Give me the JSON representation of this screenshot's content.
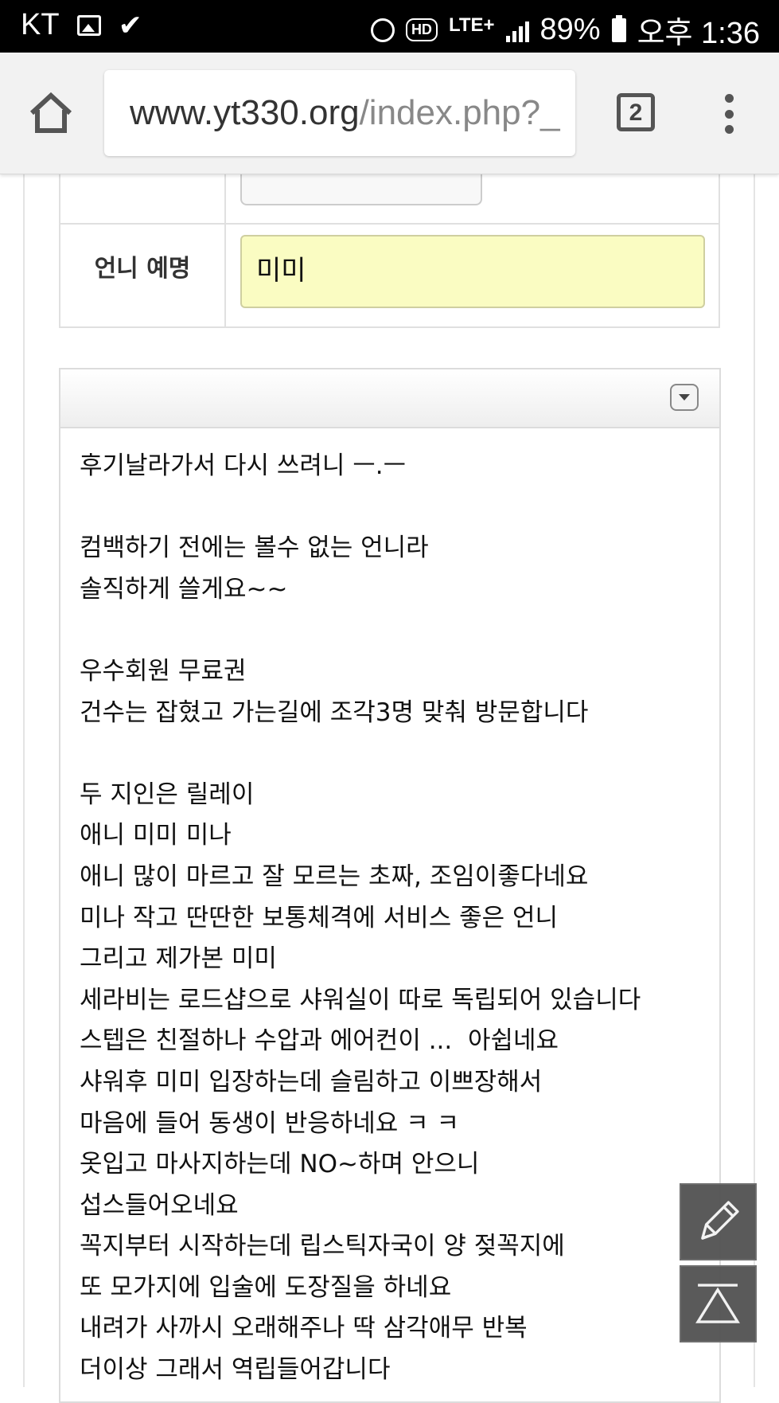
{
  "status_bar": {
    "carrier": "KT",
    "network": "LTE+",
    "hd_label": "HD",
    "battery": "89%",
    "time": "오후 1:36"
  },
  "browser": {
    "url_host": "www.yt330.org",
    "url_path": "/index.php?_",
    "tab_count": "2"
  },
  "form": {
    "nickname_label": "언니 예명",
    "nickname_value": "미미"
  },
  "review_lines": [
    "후기날라가서 다시 쓰려니 ㅡ.ㅡ",
    "",
    "컴백하기 전에는 볼수 없는 언니라",
    "솔직하게 쓸게요~~",
    "",
    "우수회원 무료권",
    "건수는 잡혔고 가는길에 조각3명 맞춰 방문합니다",
    "",
    "두 지인은 릴레이",
    "애니 미미 미나",
    "애니 많이 마르고 잘 모르는 초짜, 조임이좋다네요",
    "미나 작고 딴딴한 보통체격에 서비스 좋은 언니",
    "그리고 제가본 미미",
    "세라비는 로드샵으로 샤워실이 따로 독립되어 있습니다",
    "스텝은 친절하나 수압과 에어컨이 ...  아쉽네요",
    "샤워후 미미 입장하는데 슬림하고 이쁘장해서",
    "마음에 들어 동생이 반응하네요 ㅋ ㅋ",
    "옷입고 마사지하는데 NO~하며 안으니",
    "섭스들어오네요",
    "꼭지부터 시작하는데 립스틱자국이 양 젖꼭지에",
    "또 모가지에 입술에 도장질을 하네요",
    "내려가 사까시 오래해주나 딱 삼각애무 반복",
    "더이상 그래서 역립들어갑니다"
  ],
  "icons": {
    "home": "home-icon",
    "menu": "more-vert-icon",
    "write": "pencil-icon",
    "top": "scroll-top-icon",
    "dropdown": "chevron-down-icon"
  }
}
